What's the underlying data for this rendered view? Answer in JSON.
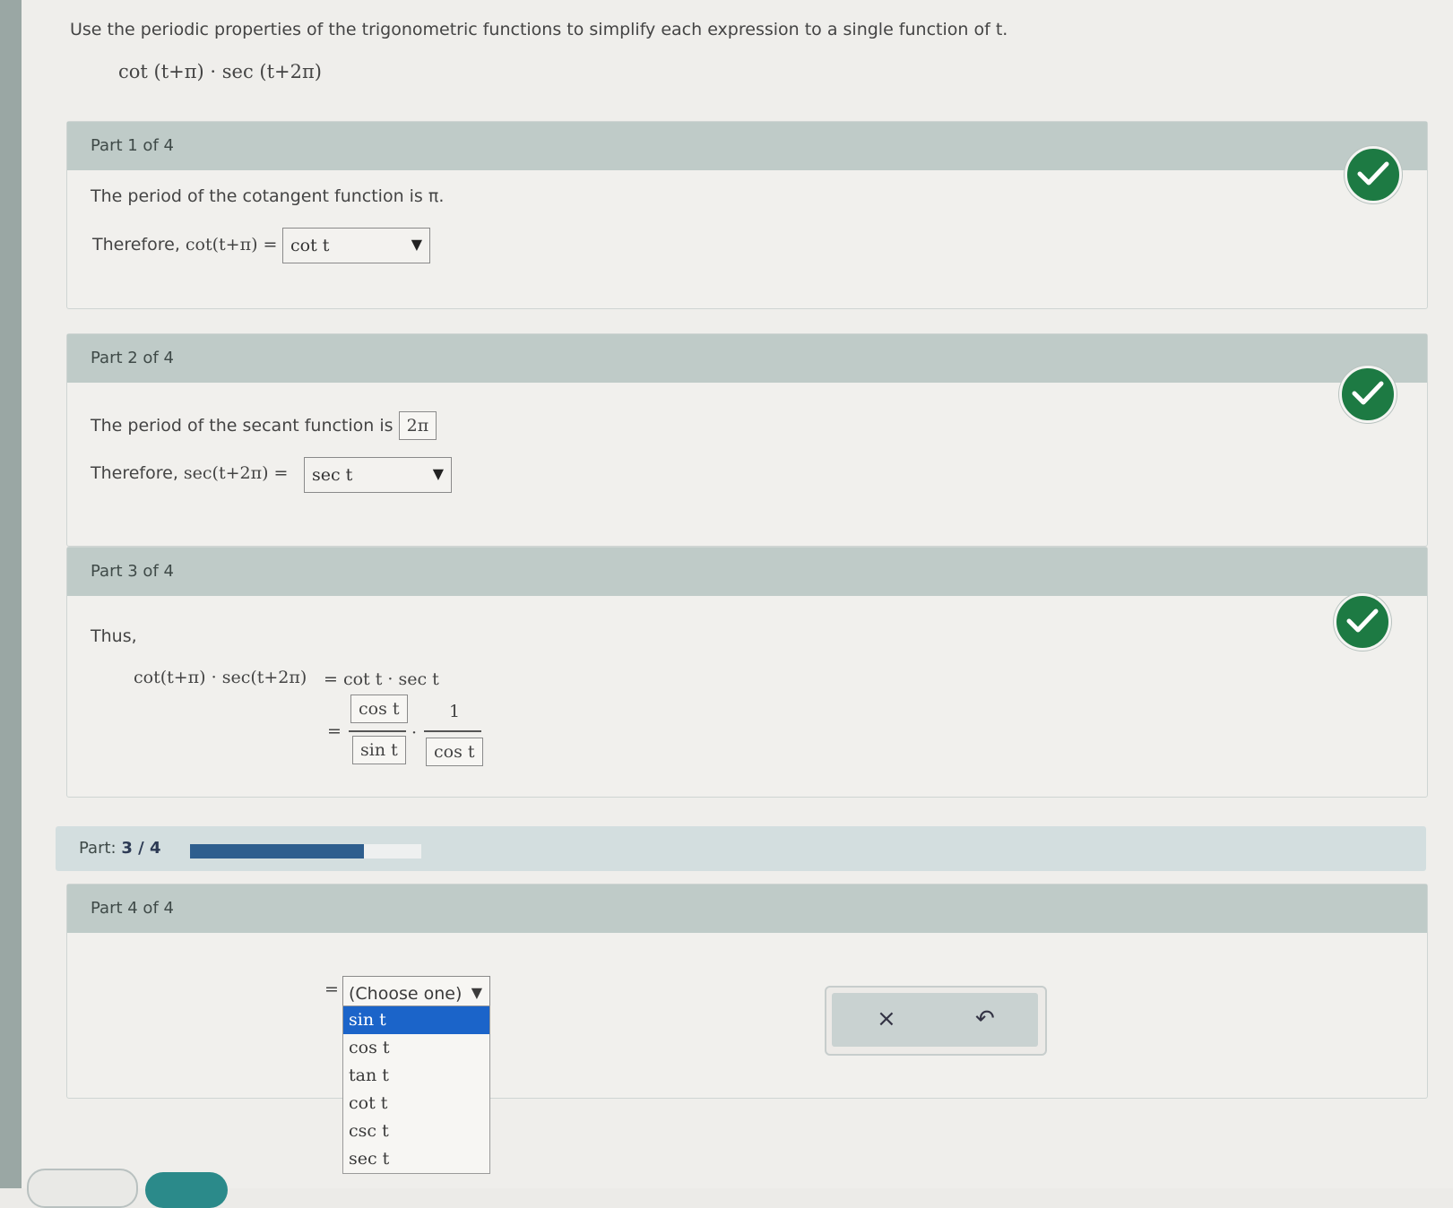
{
  "instructions": "Use the periodic properties of the trigonometric functions to simplify each expression to a single function of t.",
  "expression": "cot (t+π) · sec (t+2π)",
  "parts": [
    {
      "title": "Part 1 of 4",
      "statement": "The period of the cotangent function is π.",
      "therefore_prefix": "Therefore,",
      "therefore_lhs": "cot(t+π) =",
      "answer": "cot t",
      "status": "correct"
    },
    {
      "title": "Part 2 of 4",
      "statement_prefix": "The period of the secant function is",
      "period_answer": "2π",
      "therefore_prefix": "Therefore,",
      "therefore_lhs": "sec(t+2π) =",
      "answer": "sec t",
      "status": "correct"
    },
    {
      "title": "Part 3 of 4",
      "lead": "Thus,",
      "lhs": "cot(t+π) · sec(t+2π)",
      "rhs1": "= cot t · sec t",
      "eq": "=",
      "num1": "cos t",
      "den1": "sin t",
      "dot": "·",
      "num2": "1",
      "den2": "cos t",
      "status": "correct"
    },
    {
      "title": "Part 4 of 4",
      "eq": "=",
      "select_placeholder": "(Choose one)",
      "options": [
        "sin t",
        "cos t",
        "tan t",
        "cot t",
        "csc t",
        "sec t"
      ],
      "highlighted_option": "sin t"
    }
  ],
  "progress": {
    "label": "Part:",
    "value_text": "3 / 4",
    "current": 3,
    "total": 4,
    "fill_fraction": 0.75
  },
  "icons": {
    "check": "check-icon",
    "dropdown": "triangle-down-icon",
    "clear": "close-icon",
    "undo": "undo-icon"
  },
  "symbols": {
    "arrow": "▼",
    "clear": "×",
    "undo": "↶"
  },
  "colors": {
    "check": "#1d7a43",
    "progress": "#2e5e8e",
    "selected_option": "#1b64c9",
    "header": "#bfcbc8"
  }
}
